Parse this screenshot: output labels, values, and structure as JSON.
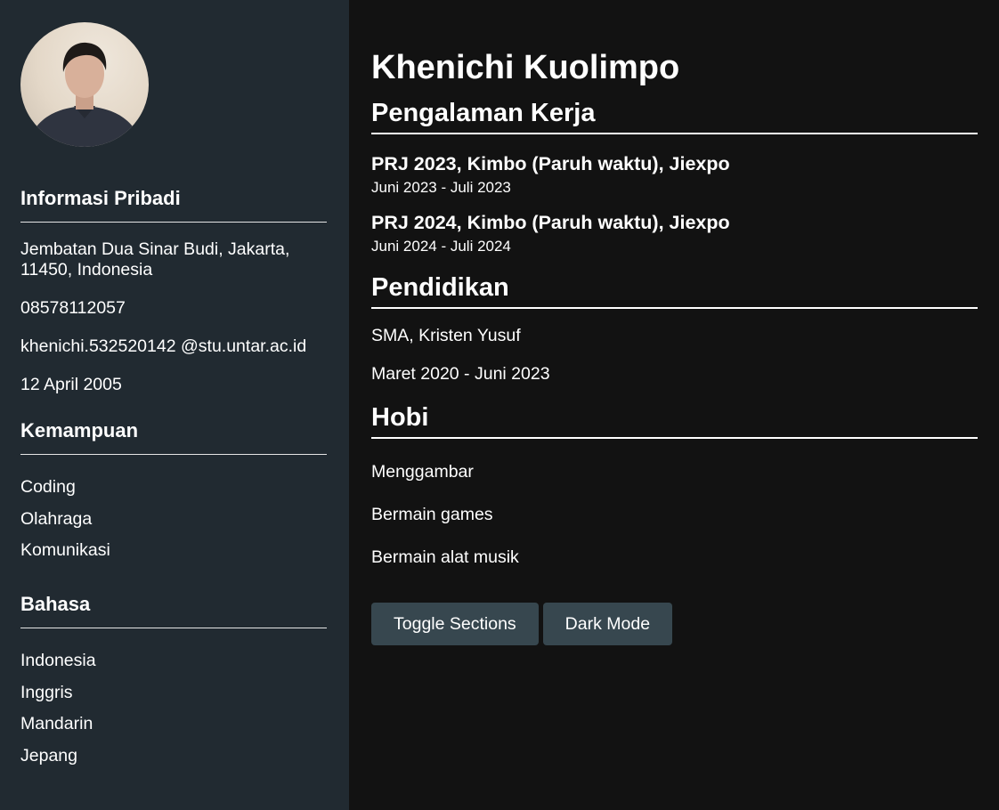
{
  "profile": {
    "name": "Khenichi Kuolimpo"
  },
  "sidebar": {
    "personal_heading": "Informasi Pribadi",
    "address": "Jembatan Dua Sinar Budi, Jakarta, 11450, Indonesia",
    "phone": "08578112057",
    "email": "khenichi.532520142 @stu.untar.ac.id",
    "birthdate": "12 April 2005",
    "skills_heading": "Kemampuan",
    "skills": [
      "Coding",
      "Olahraga",
      "Komunikasi"
    ],
    "languages_heading": "Bahasa",
    "languages": [
      "Indonesia",
      "Inggris",
      "Mandarin",
      "Jepang"
    ]
  },
  "experience": {
    "heading": "Pengalaman Kerja",
    "jobs": [
      {
        "title": "PRJ 2023, Kimbo (Paruh waktu), Jiexpo",
        "date": "Juni 2023 - Juli 2023"
      },
      {
        "title": "PRJ 2024, Kimbo (Paruh waktu), Jiexpo",
        "date": "Juni 2024 - Juli 2024"
      }
    ]
  },
  "education": {
    "heading": "Pendidikan",
    "school": "SMA, Kristen Yusuf",
    "period": "Maret 2020 - Juni 2023"
  },
  "hobbies": {
    "heading": "Hobi",
    "items": [
      "Menggambar",
      "Bermain games",
      "Bermain alat musik"
    ]
  },
  "buttons": {
    "toggle_label": "Toggle Sections",
    "dark_label": "Dark Mode"
  },
  "colors": {
    "sidebar_bg": "#212a31",
    "main_bg": "#121212",
    "button_bg": "#37474f"
  }
}
